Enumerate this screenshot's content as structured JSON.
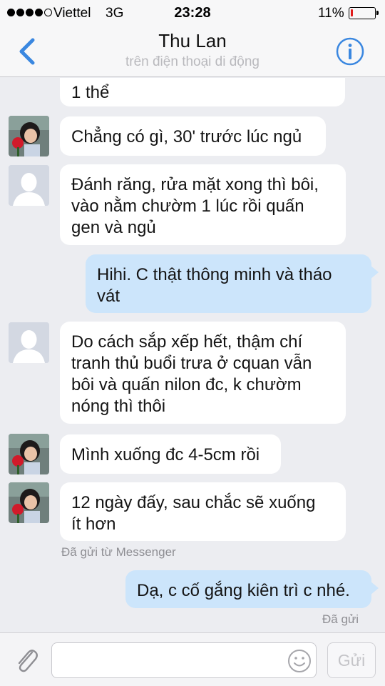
{
  "status_bar": {
    "carrier": "Viettel",
    "network": "3G",
    "time": "23:28",
    "battery_percent": "11%",
    "battery_level": 0.11,
    "battery_color": "#e01a1a"
  },
  "nav": {
    "back_icon": "chevron-left-icon",
    "title": "Thu Lan",
    "subtitle": "trên điện thoại di động",
    "info_icon": "info-icon",
    "accent_color": "#3a87e0"
  },
  "messages": [
    {
      "direction": "in",
      "text": "1 thể"
    },
    {
      "direction": "in",
      "text": "Chẳng có gì, 30' trước lúc ngủ"
    },
    {
      "direction": "in",
      "text": "Đánh răng, rửa mặt xong thì bôi,\nvào nằm chườm 1 lúc rồi quấn\ngen và ngủ"
    },
    {
      "direction": "out",
      "text": "Hihi. C thật thông minh và tháo\nvát"
    },
    {
      "direction": "in",
      "text": "Do cách sắp xếp hết, thậm chí\ntranh thủ buổi trưa ở cquan vẫn\nbôi và quấn nilon đc, k chườm\nnóng thì thôi"
    },
    {
      "direction": "in",
      "text": "Mình xuống đc 4-5cm rồi"
    },
    {
      "direction": "in",
      "text": "12 ngày đấy, sau chắc sẽ xuống\nít hơn"
    },
    {
      "direction": "out",
      "text": "Dạ, c cố gắng kiên trì c nhé."
    }
  ],
  "sent_from": "Đã gửi từ Messenger",
  "sent_status": "Đã gửi",
  "input": {
    "placeholder": "",
    "value": "",
    "send_label": "Gửi",
    "attach_icon": "paperclip-icon",
    "emoji_icon": "smiley-icon"
  },
  "colors": {
    "outgoing_bubble": "#cce5fb",
    "incoming_bubble": "#ffffff",
    "background": "#ecedf1"
  }
}
